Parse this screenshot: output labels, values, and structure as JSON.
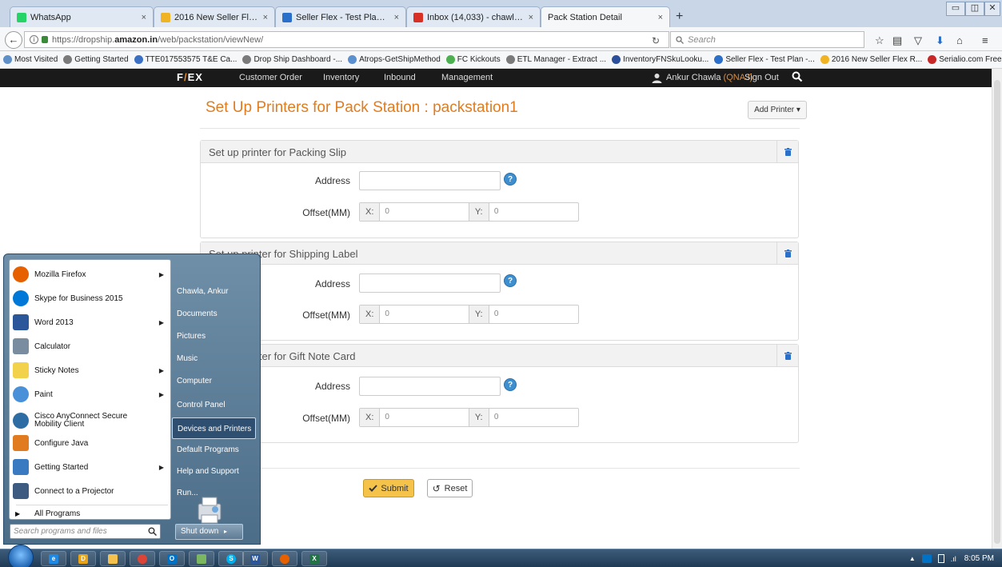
{
  "browser": {
    "tabs": [
      {
        "title": "WhatsApp",
        "close": "×",
        "icon_color": "#25d366",
        "icon": "whatsapp-icon"
      },
      {
        "title": "2016 New Seller Flex Reque...",
        "close": "×",
        "icon_color": "#f0b323",
        "icon": "sheet-icon"
      },
      {
        "title": "Seller Flex - Test Plan - Am...",
        "close": "×",
        "icon_color": "#2a6fc9",
        "icon": "wiki-icon"
      },
      {
        "title": "Inbox (14,033) - chawlaank...",
        "close": "×",
        "icon_color": "#d93025",
        "icon": "gmail-icon"
      },
      {
        "title": "Pack Station Detail",
        "close": "×",
        "icon_color": "",
        "icon": ""
      }
    ],
    "new_tab": "+",
    "url_prefix": "https://dropship.",
    "url_domain": "amazon.in",
    "url_path": "/web/packstation/viewNew/",
    "search_placeholder": "Search",
    "bookmarks": [
      {
        "label": "Most Visited",
        "color": "#5f8fc7"
      },
      {
        "label": "Getting Started",
        "color": "#7a7a7a"
      },
      {
        "label": "TTE017553575 T&E Ca...",
        "color": "#3b6fc4"
      },
      {
        "label": "Drop Ship Dashboard -...",
        "color": "#7a7a7a"
      },
      {
        "label": "Atrops-GetShipMethod",
        "color": "#5a8fd0"
      },
      {
        "label": "FC Kickouts",
        "color": "#4caf50"
      },
      {
        "label": "ETL Manager - Extract ...",
        "color": "#7a7a7a"
      },
      {
        "label": "InventoryFNSkuLooku...",
        "color": "#2c4f9c"
      },
      {
        "label": "Seller Flex - Test Plan -...",
        "color": "#2a6fc9"
      },
      {
        "label": "2016 New Seller Flex R...",
        "color": "#f0b323"
      },
      {
        "label": "Serialio.com Free Barc...",
        "color": "#c62828"
      }
    ],
    "bookmarks_overflow": "»"
  },
  "app": {
    "logo_f": "F",
    "logo_slash": "/",
    "logo_ex": "EX",
    "nav": [
      "Customer Order",
      "Inventory",
      "Inbound",
      "Management"
    ],
    "user_name": "Ankur Chawla",
    "user_code": "(QNAJ)",
    "sign_out": "Sign Out"
  },
  "page": {
    "title": "Set Up Printers for Pack Station : packstation1",
    "add_printer": "Add Printer ▾",
    "panels": [
      {
        "title": "Set up printer for Packing Slip",
        "address_label": "Address",
        "offset_label": "Offset(MM)",
        "x_label": "X:",
        "x_value": "0",
        "y_label": "Y:",
        "y_value": "0"
      },
      {
        "title": "Set up printer for Shipping Label",
        "address_label": "Address",
        "offset_label": "Offset(MM)",
        "x_label": "X:",
        "x_value": "0",
        "y_label": "Y:",
        "y_value": "0"
      },
      {
        "title": "Set up printer for Gift Note Card",
        "address_label": "Address",
        "offset_label": "Offset(MM)",
        "x_label": "X:",
        "x_value": "0",
        "y_label": "Y:",
        "y_value": "0"
      }
    ],
    "submit": "Submit",
    "reset": "Reset",
    "help": "?"
  },
  "start_menu": {
    "programs": [
      {
        "label": "Mozilla Firefox",
        "color": "#e66000",
        "submenu": true
      },
      {
        "label": "Skype for Business 2015",
        "color": "#0078d7",
        "submenu": false
      },
      {
        "label": "Word 2013",
        "color": "#2b579a",
        "submenu": true
      },
      {
        "label": "Calculator",
        "color": "#7a8da0",
        "submenu": false
      },
      {
        "label": "Sticky Notes",
        "color": "#f2d24b",
        "submenu": true
      },
      {
        "label": "Paint",
        "color": "#4a90d9",
        "submenu": true
      },
      {
        "label": "Cisco AnyConnect Secure Mobility Client",
        "color": "#2d6da3",
        "submenu": false
      },
      {
        "label": "Configure Java",
        "color": "#e07c1f",
        "submenu": false
      },
      {
        "label": "Getting Started",
        "color": "#3a7ac0",
        "submenu": true
      },
      {
        "label": "Connect to a Projector",
        "color": "#3d5a80",
        "submenu": false
      }
    ],
    "all_programs": "All Programs",
    "search_placeholder": "Search programs and files",
    "right_items": [
      "Chawla, Ankur",
      "Documents",
      "Pictures",
      "Music",
      "Computer",
      "Control Panel",
      "Devices and Printers",
      "Default Programs",
      "Help and Support",
      "Run..."
    ],
    "highlighted": "Devices and Printers",
    "shutdown": "Shut down"
  },
  "taskbar": {
    "apps": [
      {
        "icon": "ie-icon",
        "color": "#1e88e5",
        "glyph": "e"
      },
      {
        "icon": "outlook-icon",
        "color": "#e8a317",
        "glyph": "D"
      },
      {
        "icon": "explorer-icon",
        "color": "#f2c14e",
        "glyph": ""
      },
      {
        "icon": "chrome-icon",
        "color": "#db4437",
        "glyph": ""
      },
      {
        "icon": "outlook2-icon",
        "color": "#0072c6",
        "glyph": "O"
      },
      {
        "icon": "app-icon",
        "color": "#7bb661",
        "glyph": ""
      },
      {
        "icon": "skype-icon",
        "color": "#00aff0",
        "glyph": "S"
      },
      {
        "icon": "word-icon",
        "color": "#2b579a",
        "glyph": "W"
      },
      {
        "icon": "firefox-icon",
        "color": "#e66000",
        "glyph": ""
      },
      {
        "icon": "excel-icon",
        "color": "#217346",
        "glyph": "X"
      }
    ],
    "time": "8:05 PM"
  }
}
